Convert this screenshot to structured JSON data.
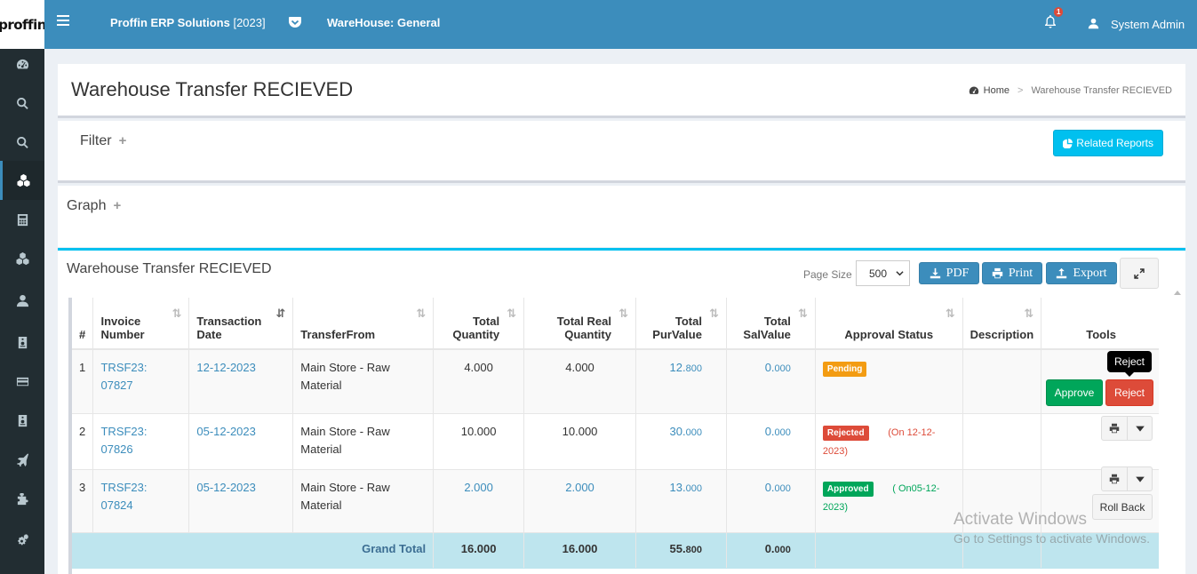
{
  "app": {
    "logo_text": "proffin",
    "logo_sub": "",
    "title": "Proffin ERP Solutions",
    "year": "[2023]",
    "warehouse": "WareHouse: General",
    "notification_count": "1",
    "user": "System Admin",
    "accent": "#3c8dbc"
  },
  "sidebar": {
    "icons": [
      "dashboard-icon",
      "search-icon",
      "search-icon",
      "cubes-icon",
      "calculator-icon",
      "cubes-icon",
      "user-icon",
      "id-card-icon",
      "credit-card-icon",
      "id-card-icon",
      "plane-icon",
      "puzzle-icon",
      "cogs-icon"
    ]
  },
  "page": {
    "title": "Warehouse Transfer RECIEVED",
    "breadcrumb_home": "Home",
    "breadcrumb_sep": ">",
    "breadcrumb_current": "Warehouse Transfer RECIEVED"
  },
  "filter": {
    "title": "Filter",
    "plus": "+",
    "related_reports": "Related Reports"
  },
  "graph": {
    "title": "Graph",
    "plus": "+"
  },
  "table_panel": {
    "title": "Warehouse Transfer RECIEVED",
    "page_size_label": "Page Size",
    "page_size_value": "500",
    "pdf": "PDF",
    "print": "Print",
    "export": "Export"
  },
  "table": {
    "headers": {
      "no": "#",
      "invoice_1": "Invoice",
      "invoice_2": "Number",
      "date_1": "Transaction",
      "date_2": "Date",
      "from": "TransferFrom",
      "qty_1": "Total",
      "qty_2": "Quantity",
      "real_1": "Total Real",
      "real_2": "Quantity",
      "pur_1": "Total",
      "pur_2": "PurValue",
      "sal_1": "Total",
      "sal_2": "SalValue",
      "status": "Approval Status",
      "desc": "Description",
      "tools": "Tools"
    },
    "rows": [
      {
        "no": "1",
        "invoice": "TRSF23: 07827",
        "date": "12-12-2023",
        "from": "Main Store - Raw Material",
        "qty": "4.000",
        "real": "4.000",
        "pur_int": "12.",
        "pur_dec": "800",
        "sal_int": "0.",
        "sal_dec": "000",
        "status": "Pending",
        "status_note": ""
      },
      {
        "no": "2",
        "invoice": "TRSF23: 07826",
        "date": "05-12-2023",
        "from": "Main Store - Raw Material",
        "qty": "10.000",
        "real": "10.000",
        "pur_int": "30.",
        "pur_dec": "000",
        "sal_int": "0.",
        "sal_dec": "000",
        "status": "Rejected",
        "status_note": "(On 12-12-2023)"
      },
      {
        "no": "3",
        "invoice": "TRSF23: 07824",
        "date": "05-12-2023",
        "from": "Main Store - Raw Material",
        "qty": "2.000",
        "real": "2.000",
        "pur_int": "13.",
        "pur_dec": "000",
        "sal_int": "0.",
        "sal_dec": "000",
        "status": "Approved",
        "status_note": "( On05-12-2023)"
      }
    ],
    "grand": {
      "label": "Grand Total",
      "qty": "16.000",
      "real": "16.000",
      "pur_int": "55.",
      "pur_dec": "800",
      "sal_int": "0.",
      "sal_dec": "000"
    }
  },
  "actions": {
    "approve": "Approve",
    "reject": "Reject",
    "reject_tooltip": "Reject",
    "rollback": "Roll Back"
  },
  "watermark": {
    "line1": "Activate Windows",
    "line2": "Go to Settings to activate Windows."
  }
}
